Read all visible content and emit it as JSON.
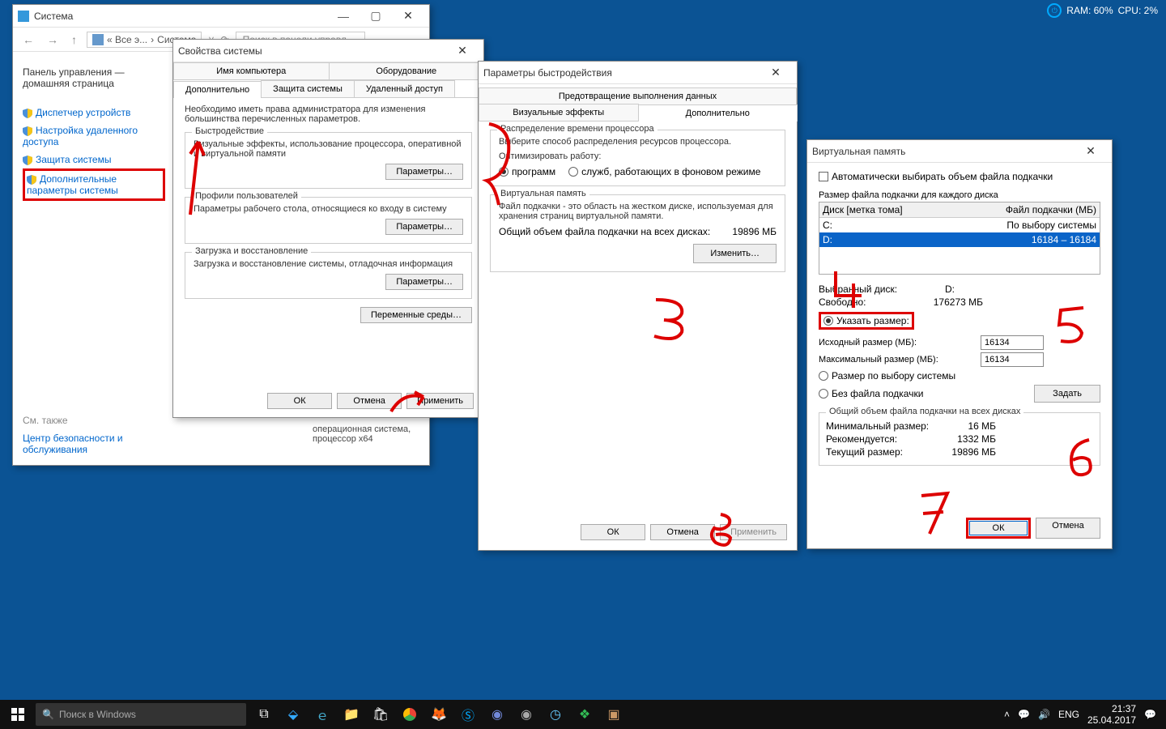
{
  "sysstat": {
    "ram": "RAM: 60%",
    "cpu": "CPU: 2%"
  },
  "explorer": {
    "title": "Система",
    "breadcrumb": [
      "« Все э...",
      "Система"
    ],
    "search_placeholder": "Поиск в панели управл…",
    "sidebar": {
      "home": "Панель управления — домашняя страница",
      "devmgr": "Диспетчер устройств",
      "remote": "Настройка удаленного доступа",
      "sysprotect": "Защита системы",
      "advsys": "Дополнительные параметры системы",
      "seealso": "См. также",
      "security": "Центр безопасности и обслуживания"
    },
    "os_info": "операционная система, процессор х64"
  },
  "sysprops": {
    "title": "Свойства системы",
    "tabs": {
      "comp_name": "Имя компьютера",
      "hardware": "Оборудование",
      "advanced": "Дополнительно",
      "sysprotect": "Защита системы",
      "remote": "Удаленный доступ"
    },
    "intro": "Необходимо иметь права администратора для изменения большинства перечисленных параметров.",
    "perf": {
      "title": "Быстродействие",
      "desc": "Визуальные эффекты, использование процессора, оперативной и виртуальной памяти",
      "btn": "Параметры…"
    },
    "profiles": {
      "title": "Профили пользователей",
      "desc": "Параметры рабочего стола, относящиеся ко входу в систему",
      "btn": "Параметры…"
    },
    "startup": {
      "title": "Загрузка и восстановление",
      "desc": "Загрузка и восстановление системы, отладочная информация",
      "btn": "Параметры…"
    },
    "envbtn": "Переменные среды…",
    "ok": "ОК",
    "cancel": "Отмена",
    "apply": "Применить"
  },
  "perfopts": {
    "title": "Параметры быстродействия",
    "tabs": {
      "visual": "Визуальные эффекты",
      "advanced": "Дополнительно",
      "dep": "Предотвращение выполнения данных"
    },
    "sched": {
      "title": "Распределение времени процессора",
      "desc": "Выберите способ распределения ресурсов процессора.",
      "optimize": "Оптимизировать работу:",
      "programs": "программ",
      "services": "служб, работающих в фоновом режиме"
    },
    "vmem": {
      "title": "Виртуальная память",
      "desc": "Файл подкачки - это область на жестком диске, используемая для хранения страниц виртуальной памяти.",
      "total_label": "Общий объем файла подкачки на всех дисках:",
      "total_value": "19896 МБ",
      "change": "Изменить…"
    },
    "ok": "ОК",
    "cancel": "Отмена",
    "apply": "Применить"
  },
  "vmem": {
    "title": "Виртуальная память",
    "auto_label": "Автоматически выбирать объем файла подкачки",
    "each_disk": "Размер файла подкачки для каждого диска",
    "col_disk": "Диск [метка тома]",
    "col_pf": "Файл подкачки (МБ)",
    "rows": [
      {
        "disk": "C:",
        "pf": "По выбору системы"
      },
      {
        "disk": "D:",
        "pf": "16184 – 16184"
      }
    ],
    "selected": {
      "drive_label": "Выбранный диск:",
      "drive": "D:",
      "free_label": "Свободно:",
      "free": "176273 МБ"
    },
    "custom": {
      "label": "Указать размер:",
      "init_label": "Исходный размер (МБ):",
      "init": "16134",
      "max_label": "Максимальный размер (МБ):",
      "max": "16134"
    },
    "sys_managed": "Размер по выбору системы",
    "no_pf": "Без файла подкачки",
    "set": "Задать",
    "total_title": "Общий объем файла подкачки на всех дисках",
    "min_label": "Минимальный размер:",
    "min": "16 МБ",
    "rec_label": "Рекомендуется:",
    "rec": "1332 МБ",
    "cur_label": "Текущий размер:",
    "cur": "19896 МБ",
    "ok": "ОК",
    "cancel": "Отмена"
  },
  "taskbar": {
    "search": "Поиск в Windows",
    "lang": "ENG",
    "time": "21:37",
    "date": "25.04.2017"
  }
}
